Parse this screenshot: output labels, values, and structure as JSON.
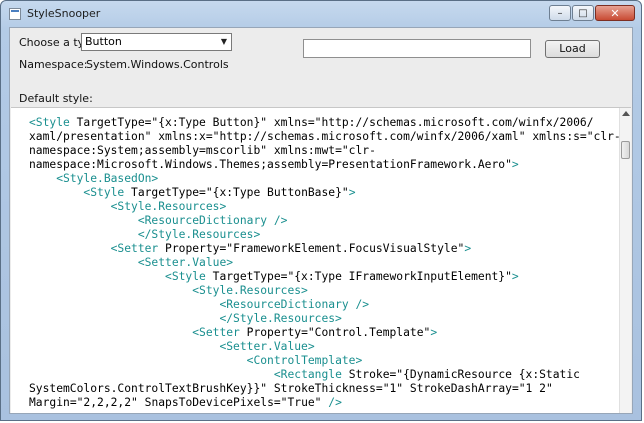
{
  "window": {
    "title": "StyleSnooper",
    "min_glyph": "–",
    "max_glyph": "□",
    "close_glyph": "✕"
  },
  "controls": {
    "choose_label": "Choose a type:",
    "type_selected": "Button",
    "namespace_label": "Namespace:",
    "namespace_value": "System.Windows.Controls",
    "url_value": "",
    "load_label": "Load",
    "default_style_label": "Default style:"
  },
  "code_lines": [
    [
      [
        "t",
        "<Style "
      ],
      [
        "a",
        "TargetType"
      ],
      [
        "v",
        "=\"{x:Type Button}\" "
      ],
      [
        "a",
        "xmlns"
      ],
      [
        "v",
        "=\"http://schemas.microsoft.com/winfx/2006/"
      ]
    ],
    [
      [
        "v",
        "xaml/presentation\" "
      ],
      [
        "a",
        "xmlns:x"
      ],
      [
        "v",
        "=\"http://schemas.microsoft.com/winfx/2006/xaml\" "
      ],
      [
        "a",
        "xmlns:s"
      ],
      [
        "v",
        "=\"clr-"
      ]
    ],
    [
      [
        "v",
        "namespace:System;assembly=mscorlib\" "
      ],
      [
        "a",
        "xmlns:mwt"
      ],
      [
        "v",
        "=\"clr-"
      ]
    ],
    [
      [
        "v",
        "namespace:Microsoft.Windows.Themes;assembly=PresentationFramework.Aero\""
      ],
      [
        "t",
        ">"
      ]
    ],
    [
      [
        "v",
        "    "
      ],
      [
        "t",
        "<Style.BasedOn>"
      ]
    ],
    [
      [
        "v",
        "        "
      ],
      [
        "t",
        "<Style "
      ],
      [
        "a",
        "TargetType"
      ],
      [
        "v",
        "=\"{x:Type ButtonBase}\""
      ],
      [
        "t",
        ">"
      ]
    ],
    [
      [
        "v",
        "            "
      ],
      [
        "t",
        "<Style.Resources>"
      ]
    ],
    [
      [
        "v",
        "                "
      ],
      [
        "t",
        "<ResourceDictionary />"
      ]
    ],
    [
      [
        "v",
        "                "
      ],
      [
        "t",
        "</Style.Resources>"
      ]
    ],
    [
      [
        "v",
        "            "
      ],
      [
        "t",
        "<Setter "
      ],
      [
        "a",
        "Property"
      ],
      [
        "v",
        "=\"FrameworkElement.FocusVisualStyle\""
      ],
      [
        "t",
        ">"
      ]
    ],
    [
      [
        "v",
        "                "
      ],
      [
        "t",
        "<Setter.Value>"
      ]
    ],
    [
      [
        "v",
        "                    "
      ],
      [
        "t",
        "<Style "
      ],
      [
        "a",
        "TargetType"
      ],
      [
        "v",
        "=\"{x:Type IFrameworkInputElement}\""
      ],
      [
        "t",
        ">"
      ]
    ],
    [
      [
        "v",
        "                        "
      ],
      [
        "t",
        "<Style.Resources>"
      ]
    ],
    [
      [
        "v",
        "                            "
      ],
      [
        "t",
        "<ResourceDictionary />"
      ]
    ],
    [
      [
        "v",
        "                            "
      ],
      [
        "t",
        "</Style.Resources>"
      ]
    ],
    [
      [
        "v",
        "                        "
      ],
      [
        "t",
        "<Setter "
      ],
      [
        "a",
        "Property"
      ],
      [
        "v",
        "=\"Control.Template\""
      ],
      [
        "t",
        ">"
      ]
    ],
    [
      [
        "v",
        "                            "
      ],
      [
        "t",
        "<Setter.Value>"
      ]
    ],
    [
      [
        "v",
        "                                "
      ],
      [
        "t",
        "<ControlTemplate>"
      ]
    ],
    [
      [
        "v",
        "                                    "
      ],
      [
        "t",
        "<Rectangle "
      ],
      [
        "a",
        "Stroke"
      ],
      [
        "v",
        "=\"{DynamicResource {x:Static"
      ]
    ],
    [
      [
        "v",
        "SystemColors.ControlTextBrushKey}}\" "
      ],
      [
        "a",
        "StrokeThickness"
      ],
      [
        "v",
        "=\"1\" "
      ],
      [
        "a",
        "StrokeDashArray"
      ],
      [
        "v",
        "=\"1 2\""
      ]
    ],
    [
      [
        "a",
        "Margin"
      ],
      [
        "v",
        "=\"2,2,2,2\" "
      ],
      [
        "a",
        "SnapsToDevicePixels"
      ],
      [
        "v",
        "=\"True\" "
      ],
      [
        "t",
        "/>"
      ]
    ]
  ]
}
